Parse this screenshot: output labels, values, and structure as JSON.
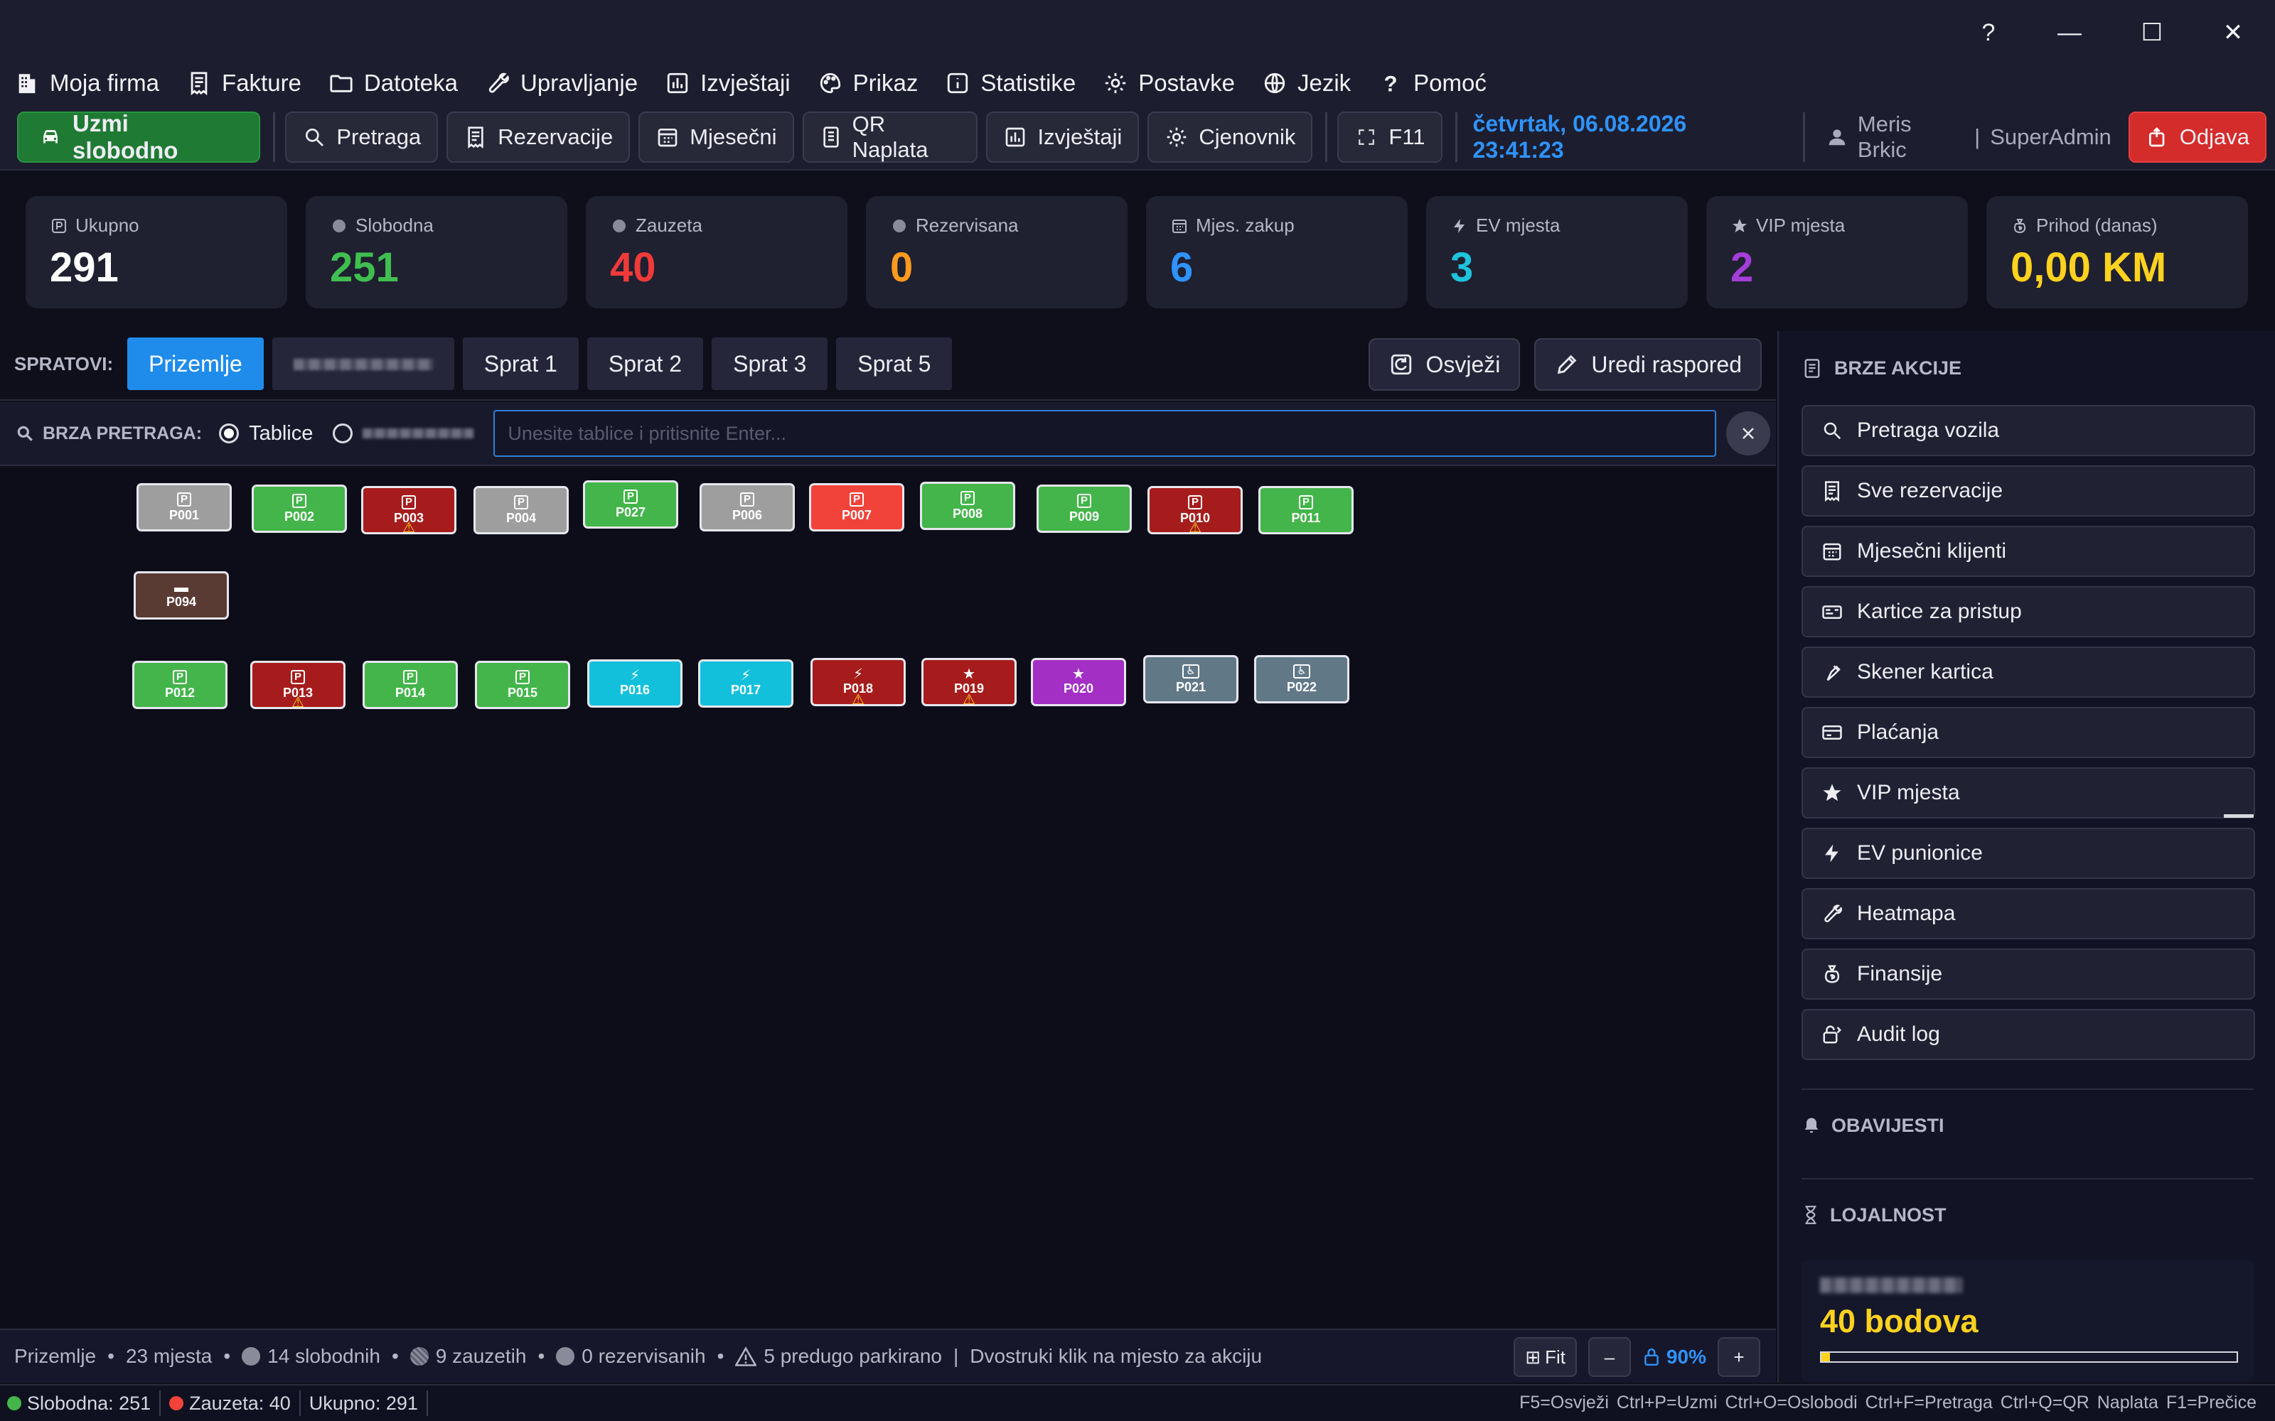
{
  "window": {
    "help": "?",
    "minimize": "—",
    "maximize": "☐",
    "close": "✕"
  },
  "menu": [
    {
      "label": "Moja firma",
      "icon": "building-icon"
    },
    {
      "label": "Fakture",
      "icon": "receipt-icon"
    },
    {
      "label": "Datoteka",
      "icon": "folder-icon"
    },
    {
      "label": "Upravljanje",
      "icon": "wrench-icon"
    },
    {
      "label": "Izvještaji",
      "icon": "bar-chart-icon"
    },
    {
      "label": "Prikaz",
      "icon": "palette-icon"
    },
    {
      "label": "Statistike",
      "icon": "info-icon"
    },
    {
      "label": "Postavke",
      "icon": "gear-icon"
    },
    {
      "label": "Jezik",
      "icon": "globe-icon"
    },
    {
      "label": "Pomoć",
      "icon": "question-icon"
    }
  ],
  "toolbar": {
    "primary_label": "Uzmi slobodno",
    "buttons": [
      "Pretraga",
      "Rezervacije",
      "Mjesečni",
      "QR Naplata",
      "Izvještaji",
      "Cjenovnik"
    ],
    "fullscreen_label": "F11",
    "datetime": "četvrtak, 06.08.2026 23:41:23",
    "user_name": "Meris Brkic",
    "user_sep": "|",
    "user_role": "SuperAdmin",
    "logout_label": "Odjava"
  },
  "stats": [
    {
      "label": "Ukupno",
      "value": "291",
      "color": "#ffffff",
      "icon": "parking-icon"
    },
    {
      "label": "Slobodna",
      "value": "251",
      "color": "#3fbf4f",
      "icon": "dot-icon"
    },
    {
      "label": "Zauzeta",
      "value": "40",
      "color": "#f03a3a",
      "icon": "dot-icon"
    },
    {
      "label": "Rezervisana",
      "value": "0",
      "color": "#ff9a1f",
      "icon": "dot-icon"
    },
    {
      "label": "Mjes. zakup",
      "value": "6",
      "color": "#2f93ff",
      "icon": "calendar-icon"
    },
    {
      "label": "EV mjesta",
      "value": "3",
      "color": "#1ec3dc",
      "icon": "bolt-icon"
    },
    {
      "label": "VIP mjesta",
      "value": "2",
      "color": "#a43ed8",
      "icon": "star-icon"
    },
    {
      "label": "Prihod (danas)",
      "value": "0,00 KM",
      "color": "#ffd21f",
      "icon": "money-bag-icon"
    }
  ],
  "floors": {
    "label": "SPRATOVI:",
    "tabs": [
      "Prizemlje",
      "",
      "Sprat 1",
      "Sprat 2",
      "Sprat 3",
      "Sprat 5"
    ],
    "active_index": 0,
    "refresh_label": "Osvježi",
    "edit_label": "Uredi raspored"
  },
  "search": {
    "label": "BRZA PRETRAGA:",
    "option_plates": "Tablice",
    "placeholder": "Unesite tablice i pritisnite Enter..."
  },
  "spots": [
    {
      "id": "P001",
      "type": "parking",
      "status": "neutral"
    },
    {
      "id": "P002",
      "type": "parking",
      "status": "free"
    },
    {
      "id": "P003",
      "type": "parking",
      "status": "long",
      "warn": true
    },
    {
      "id": "P004",
      "type": "parking",
      "status": "neutral"
    },
    {
      "id": "P027",
      "type": "parking",
      "status": "free"
    },
    {
      "id": "P006",
      "type": "parking",
      "status": "neutral"
    },
    {
      "id": "P007",
      "type": "parking",
      "status": "occupied"
    },
    {
      "id": "P008",
      "type": "parking",
      "status": "free"
    },
    {
      "id": "P009",
      "type": "parking",
      "status": "free"
    },
    {
      "id": "P010",
      "type": "parking",
      "status": "long",
      "warn": true
    },
    {
      "id": "P011",
      "type": "parking",
      "status": "free"
    },
    {
      "id": "P094",
      "type": "car",
      "status": "brown"
    },
    {
      "id": "P012",
      "type": "parking",
      "status": "free"
    },
    {
      "id": "P013",
      "type": "parking",
      "status": "long",
      "warn": true
    },
    {
      "id": "P014",
      "type": "parking",
      "status": "free"
    },
    {
      "id": "P015",
      "type": "parking",
      "status": "free"
    },
    {
      "id": "P016",
      "type": "ev",
      "status": "ev"
    },
    {
      "id": "P017",
      "type": "ev",
      "status": "ev"
    },
    {
      "id": "P018",
      "type": "ev",
      "status": "long",
      "warn": true
    },
    {
      "id": "P019",
      "type": "vip",
      "status": "long",
      "warn": true
    },
    {
      "id": "P020",
      "type": "vip",
      "status": "vip"
    },
    {
      "id": "P021",
      "type": "disabled",
      "status": "slate"
    },
    {
      "id": "P022",
      "type": "disabled",
      "status": "slate"
    }
  ],
  "mapfoot": {
    "floor": "Prizemlje",
    "places": "23 mjesta",
    "free": "14 slobodnih",
    "occupied": "9 zauzetih",
    "reserved": "0 rezervisanih",
    "long_parked": "5 predugo parkirano",
    "hint": "Dvostruki klik na mjesto za akciju",
    "fit_label": "Fit",
    "zoom_out": "–",
    "zoom_value": "90%",
    "zoom_in": "+"
  },
  "statusbar": {
    "free": "Slobodna: 251",
    "occupied": "Zauzeta: 40",
    "total": "Ukupno: 291",
    "shortcuts": "F5=Osvježi  Ctrl+P=Uzmi  Ctrl+O=Oslobodi  Ctrl+F=Pretraga  Ctrl+Q=QR Naplata  F1=Prečice"
  },
  "quick_actions": {
    "title": "BRZE AKCIJE",
    "items": [
      {
        "label": "Pretraga vozila",
        "icon": "search-icon"
      },
      {
        "label": "Sve rezervacije",
        "icon": "receipt-icon"
      },
      {
        "label": "Mjesečni klijenti",
        "icon": "calendar-icon"
      },
      {
        "label": "Kartice za pristup",
        "icon": "id-card-icon"
      },
      {
        "label": "Skener kartica",
        "icon": "scanner-icon"
      },
      {
        "label": "Plaćanja",
        "icon": "credit-card-icon"
      },
      {
        "label": "VIP mjesta",
        "icon": "star-icon"
      },
      {
        "label": "EV punionice",
        "icon": "bolt-icon"
      },
      {
        "label": "Heatmapa",
        "icon": "wrench-icon"
      },
      {
        "label": "Finansije",
        "icon": "money-bag-icon"
      },
      {
        "label": "Audit log",
        "icon": "lock-icon"
      }
    ]
  },
  "notifications": {
    "title": "OBAVIJESTI"
  },
  "loyalty": {
    "title": "LOJALNOST",
    "points": "40 bodova",
    "progress": 0.02
  },
  "colors": {
    "free": "#43b54a",
    "occupied": "#f2433a",
    "long": "#a61c1c",
    "neutral": "#9e9e9e",
    "ev": "#12c0dc",
    "vip": "#a32fc4",
    "brown": "#5a3b33",
    "slate": "#617887"
  }
}
